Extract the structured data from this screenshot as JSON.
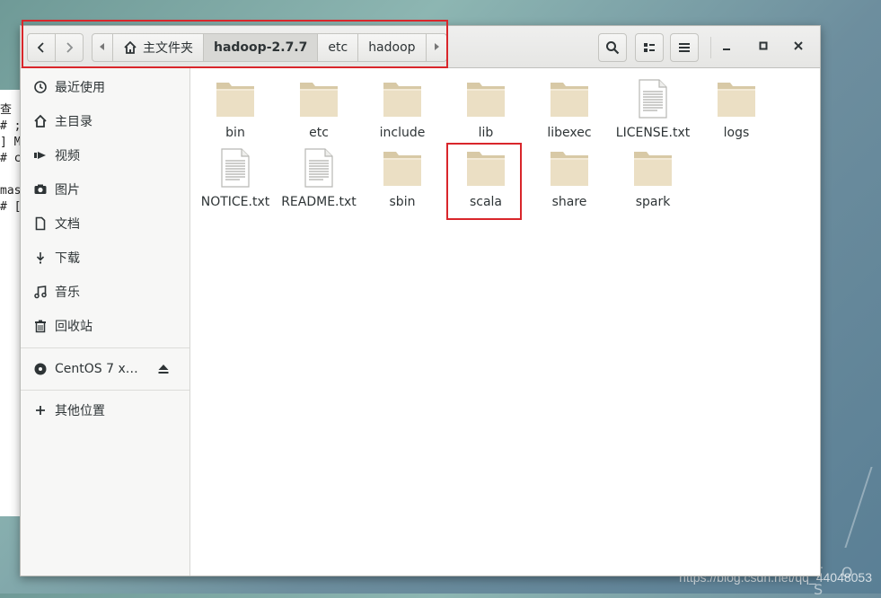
{
  "background": {
    "terminal_lines": [
      "查",
      "# ;",
      "] Ma",
      "# c",
      "",
      "mast",
      "# ["
    ],
    "desktop_letters": "T O S",
    "watermark": "https://blog.csdn.net/qq_44048053"
  },
  "header": {
    "path": [
      {
        "label": "主文件夹",
        "icon": "home-icon"
      },
      {
        "label": "hadoop-2.7.7",
        "current": true
      },
      {
        "label": "etc"
      },
      {
        "label": "hadoop"
      }
    ],
    "buttons": {
      "back": "chevron-left-icon",
      "forward": "chevron-right-icon",
      "path_left": "triangle-left-icon",
      "path_right": "triangle-right-icon",
      "search": "search-icon",
      "view": "list-view-icon",
      "menu": "hamburger-menu-icon",
      "minimize": "minimize-icon",
      "maximize": "maximize-icon",
      "close": "close-icon"
    }
  },
  "sidebar": {
    "items": [
      {
        "label": "最近使用",
        "icon": "clock-icon"
      },
      {
        "label": "主目录",
        "icon": "home-icon"
      },
      {
        "label": "视频",
        "icon": "video-icon"
      },
      {
        "label": "图片",
        "icon": "camera-icon"
      },
      {
        "label": "文档",
        "icon": "document-icon"
      },
      {
        "label": "下载",
        "icon": "download-icon"
      },
      {
        "label": "音乐",
        "icon": "music-icon"
      },
      {
        "label": "回收站",
        "icon": "trash-icon"
      }
    ],
    "device": {
      "label": "CentOS 7 x…",
      "icon": "disc-icon",
      "action_icon": "eject-icon"
    },
    "other": {
      "label": "其他位置",
      "icon": "plus-icon"
    }
  },
  "files": [
    {
      "name": "bin",
      "type": "folder"
    },
    {
      "name": "etc",
      "type": "folder"
    },
    {
      "name": "include",
      "type": "folder"
    },
    {
      "name": "lib",
      "type": "folder"
    },
    {
      "name": "libexec",
      "type": "folder"
    },
    {
      "name": "LICENSE.txt",
      "type": "text"
    },
    {
      "name": "logs",
      "type": "folder"
    },
    {
      "name": "NOTICE.txt",
      "type": "text"
    },
    {
      "name": "README.txt",
      "type": "text"
    },
    {
      "name": "sbin",
      "type": "folder"
    },
    {
      "name": "scala",
      "type": "folder",
      "highlighted": true
    },
    {
      "name": "share",
      "type": "folder"
    },
    {
      "name": "spark",
      "type": "folder"
    }
  ],
  "colors": {
    "highlight": "#d9262b",
    "folder": "#e8dcc0",
    "folder_tab": "#d3c4a2"
  }
}
